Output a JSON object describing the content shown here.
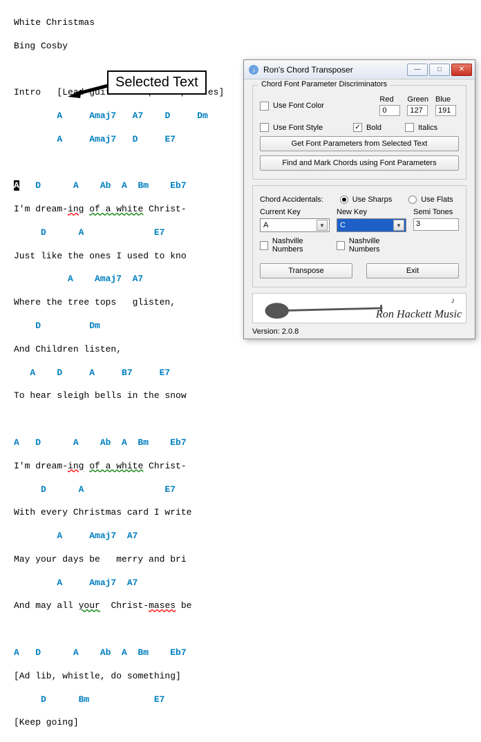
{
  "doc": {
    "title": "White Christmas",
    "artist": "Bing Cosby",
    "intro_label": "Intro",
    "intro_note": "[Lead guitar - 2 pick up notes]",
    "row_chords_1": "A     Amaj7   A7    D     Dm",
    "row_chords_2": "A     Amaj7   D     E7",
    "sel_chord": "A",
    "v1_ch": "   D      A    Ab  A  Bm    Eb7",
    "v1_ly": "I'm dream-ing of a white Christ-",
    "v2_ch": "     D      A             E7",
    "v2_ly": "Just like the ones I used to kno",
    "v3_ch": "          A    Amaj7  A7",
    "v3_ly": "Where the tree tops   glisten,",
    "v4_ch": "    D         Dm",
    "v4_ly": "And Children listen,",
    "v5_ch": "   A    D     A     B7     E7",
    "v5_ly": "To hear sleigh bells in the snow",
    "v6_ch": "A   D      A    Ab  A  Bm    Eb7",
    "v6_ly": "I'm dream-ing of a white Christ-",
    "v7_ch": "     D      A               E7",
    "v7_ly": "With every Christmas card I write",
    "v8_ch": "        A     Amaj7  A7",
    "v8_ly": "May your days be   merry and bri",
    "v9_ch": "        A     Amaj7  A7",
    "v9_ly": "And may all your  Christ-mases be",
    "v10_ch": "A   D      A    Ab  A  Bm    Eb7",
    "v10_ly": "[Ad lib, whistle, do something]",
    "v11_ch": "     D      Bm            E7",
    "v11_ly": "[Keep going]"
  },
  "callout": "Selected Text",
  "dialog": {
    "title": "Ron's Chord Transposer",
    "group1_title": "Chord Font Parameter Discriminators",
    "use_font_color": "Use Font Color",
    "red_lbl": "Red",
    "green_lbl": "Green",
    "blue_lbl": "Blue",
    "red_val": "0",
    "green_val": "127",
    "blue_val": "191",
    "use_font_style": "Use Font Style",
    "bold": "Bold",
    "bold_checked": true,
    "italics": "Italics",
    "btn_get": "Get Font Parameters from Selected Text",
    "btn_find": "Find and Mark Chords using Font Parameters",
    "accidentals_lbl": "Chord Accidentals:",
    "use_sharps": "Use Sharps",
    "use_flats": "Use Flats",
    "current_key_lbl": "Current Key",
    "new_key_lbl": "New Key",
    "semi_lbl": "Semi Tones",
    "current_key_val": "A",
    "new_key_val": "C",
    "semi_val": "3",
    "nash1": "Nashville Numbers",
    "nash2": "Nashville Numbers",
    "btn_transpose": "Transpose",
    "btn_exit": "Exit",
    "brand_text": "Ron Hackett Music",
    "version": "Version: 2.0.8"
  }
}
